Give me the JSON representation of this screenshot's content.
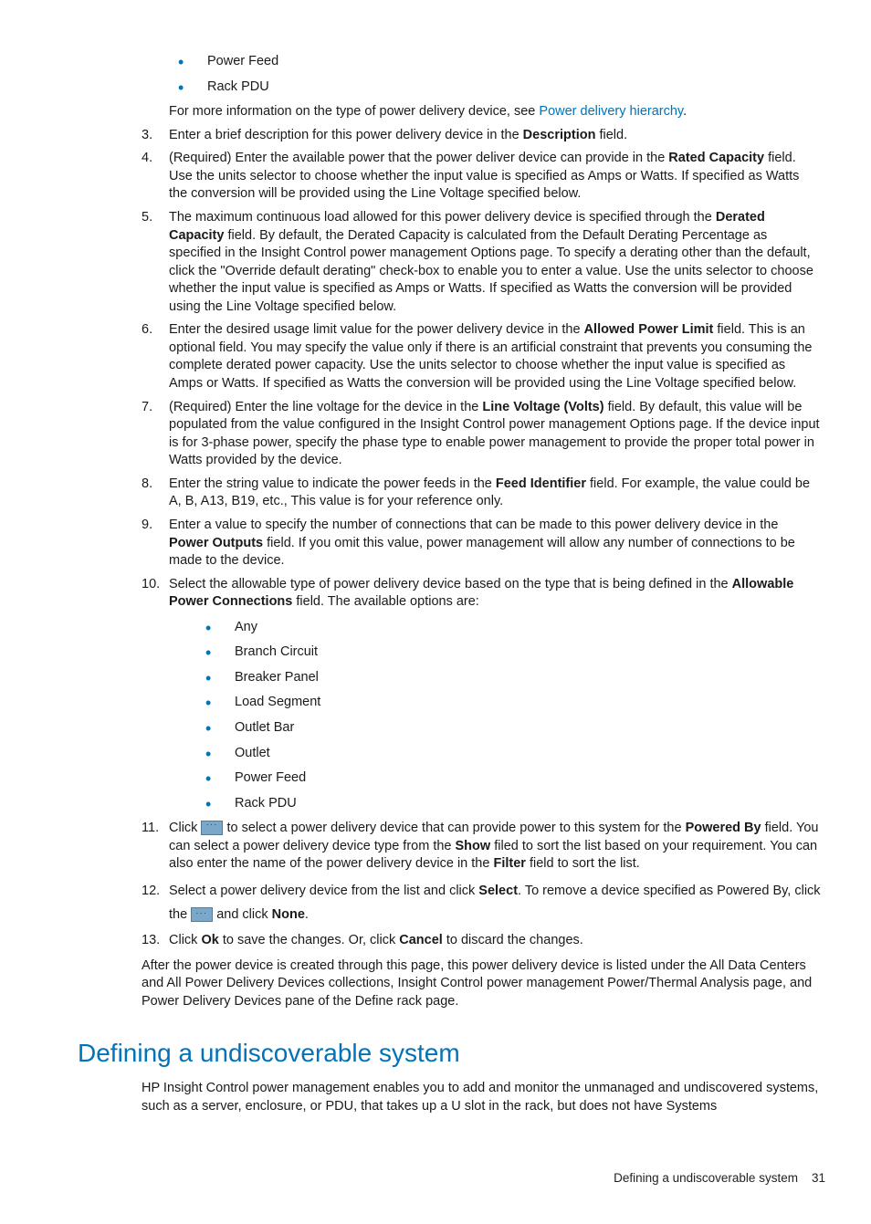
{
  "top_bullets": [
    "Power Feed",
    "Rack PDU"
  ],
  "top_info_pre": "For more information on the type of power delivery device, see ",
  "top_info_link": "Power delivery hierarchy",
  "top_info_post": ".",
  "steps": {
    "s3": {
      "pre": "Enter a brief description for this power delivery device in the ",
      "b1": "Description",
      "post": " field."
    },
    "s4": {
      "pre": "(Required) Enter the available power that the power deliver device can provide in the ",
      "b1": "Rated Capacity",
      "post": " field. Use the units selector to choose whether the input value is specified as Amps or Watts. If specified as Watts the conversion will be provided using the Line Voltage specified below."
    },
    "s5": {
      "pre": "The maximum continuous load allowed for this power delivery device is specified through the ",
      "b1": "Derated Capacity",
      "post": " field. By default, the Derated Capacity is calculated from the Default Derating Percentage as specified in the Insight Control power management Options page. To specify a derating other than the default, click the \"Override default derating\" check-box to enable you to enter a value. Use the units selector to choose whether the input value is specified as Amps or Watts. If specified as Watts the conversion will be provided using the Line Voltage specified below."
    },
    "s6": {
      "pre": "Enter the desired usage limit value for the power delivery device in the ",
      "b1": "Allowed Power Limit",
      "post": " field. This is an optional field. You may specify the value only if there is an artificial constraint that prevents you consuming the complete derated power capacity. Use the units selector to choose whether the input value is specified as Amps or Watts. If specified as Watts the conversion will be provided using the Line Voltage specified below."
    },
    "s7": {
      "pre": "(Required) Enter the line voltage for the device in the ",
      "b1": "Line Voltage (Volts)",
      "post": " field. By default, this value will be populated from the value configured in the Insight Control power management Options page. If the device input is for 3-phase power, specify the phase type to enable power management to provide the proper total power in Watts provided by the device."
    },
    "s8": {
      "pre": "Enter the string value to indicate the power feeds in the ",
      "b1": "Feed Identifier",
      "post": " field. For example, the value could be A, B, A13, B19, etc., This value is for your reference only."
    },
    "s9": {
      "pre": "Enter a value to specify the number of connections that can be made to this power delivery device in the ",
      "b1": "Power Outputs",
      "post": " field. If you omit this value, power management will allow any number of connections to be made to the device."
    },
    "s10": {
      "pre": "Select the allowable type of power delivery device based on the type that is being defined in the ",
      "b1": "Allowable Power Connections",
      "post": " field. The available options are:"
    },
    "s11": {
      "pre": "Click ",
      "mid": " to select a power delivery device that can provide power to this system for the ",
      "b1": "Powered By",
      "mid2": " field. You can select a power delivery device type from the ",
      "b2": "Show",
      "mid3": " filed to sort the list based on your requirement. You can also enter the name of the power delivery device in the ",
      "b3": "Filter",
      "post": " field to sort the list."
    },
    "s12": {
      "pre": "Select a power delivery device from the list and click ",
      "b1": "Select",
      "mid": ". To remove a device specified as Powered By, click the ",
      "mid2": " and click ",
      "b2": "None",
      "post": "."
    },
    "s13": {
      "pre": "Click ",
      "b1": "Ok",
      "mid": " to save the changes. Or, click ",
      "b2": "Cancel",
      "post": " to discard the changes."
    }
  },
  "options_list": [
    "Any",
    "Branch Circuit",
    "Breaker Panel",
    "Load Segment",
    "Outlet Bar",
    "Outlet",
    "Power Feed",
    "Rack PDU"
  ],
  "after_para": "After the power device is created through this page, this power delivery device is listed under the All Data Centers and All Power Delivery Devices collections, Insight Control power management Power/Thermal Analysis page, and Power Delivery Devices pane of the Define rack page.",
  "section_heading": "Defining a undiscoverable system",
  "section_para": "HP Insight Control power management enables you to add and monitor the unmanaged and undiscovered systems, such as a server, enclosure, or PDU, that takes up a U slot in the rack, but does not have Systems",
  "footer_text": "Defining a undiscoverable system",
  "footer_page": "31"
}
